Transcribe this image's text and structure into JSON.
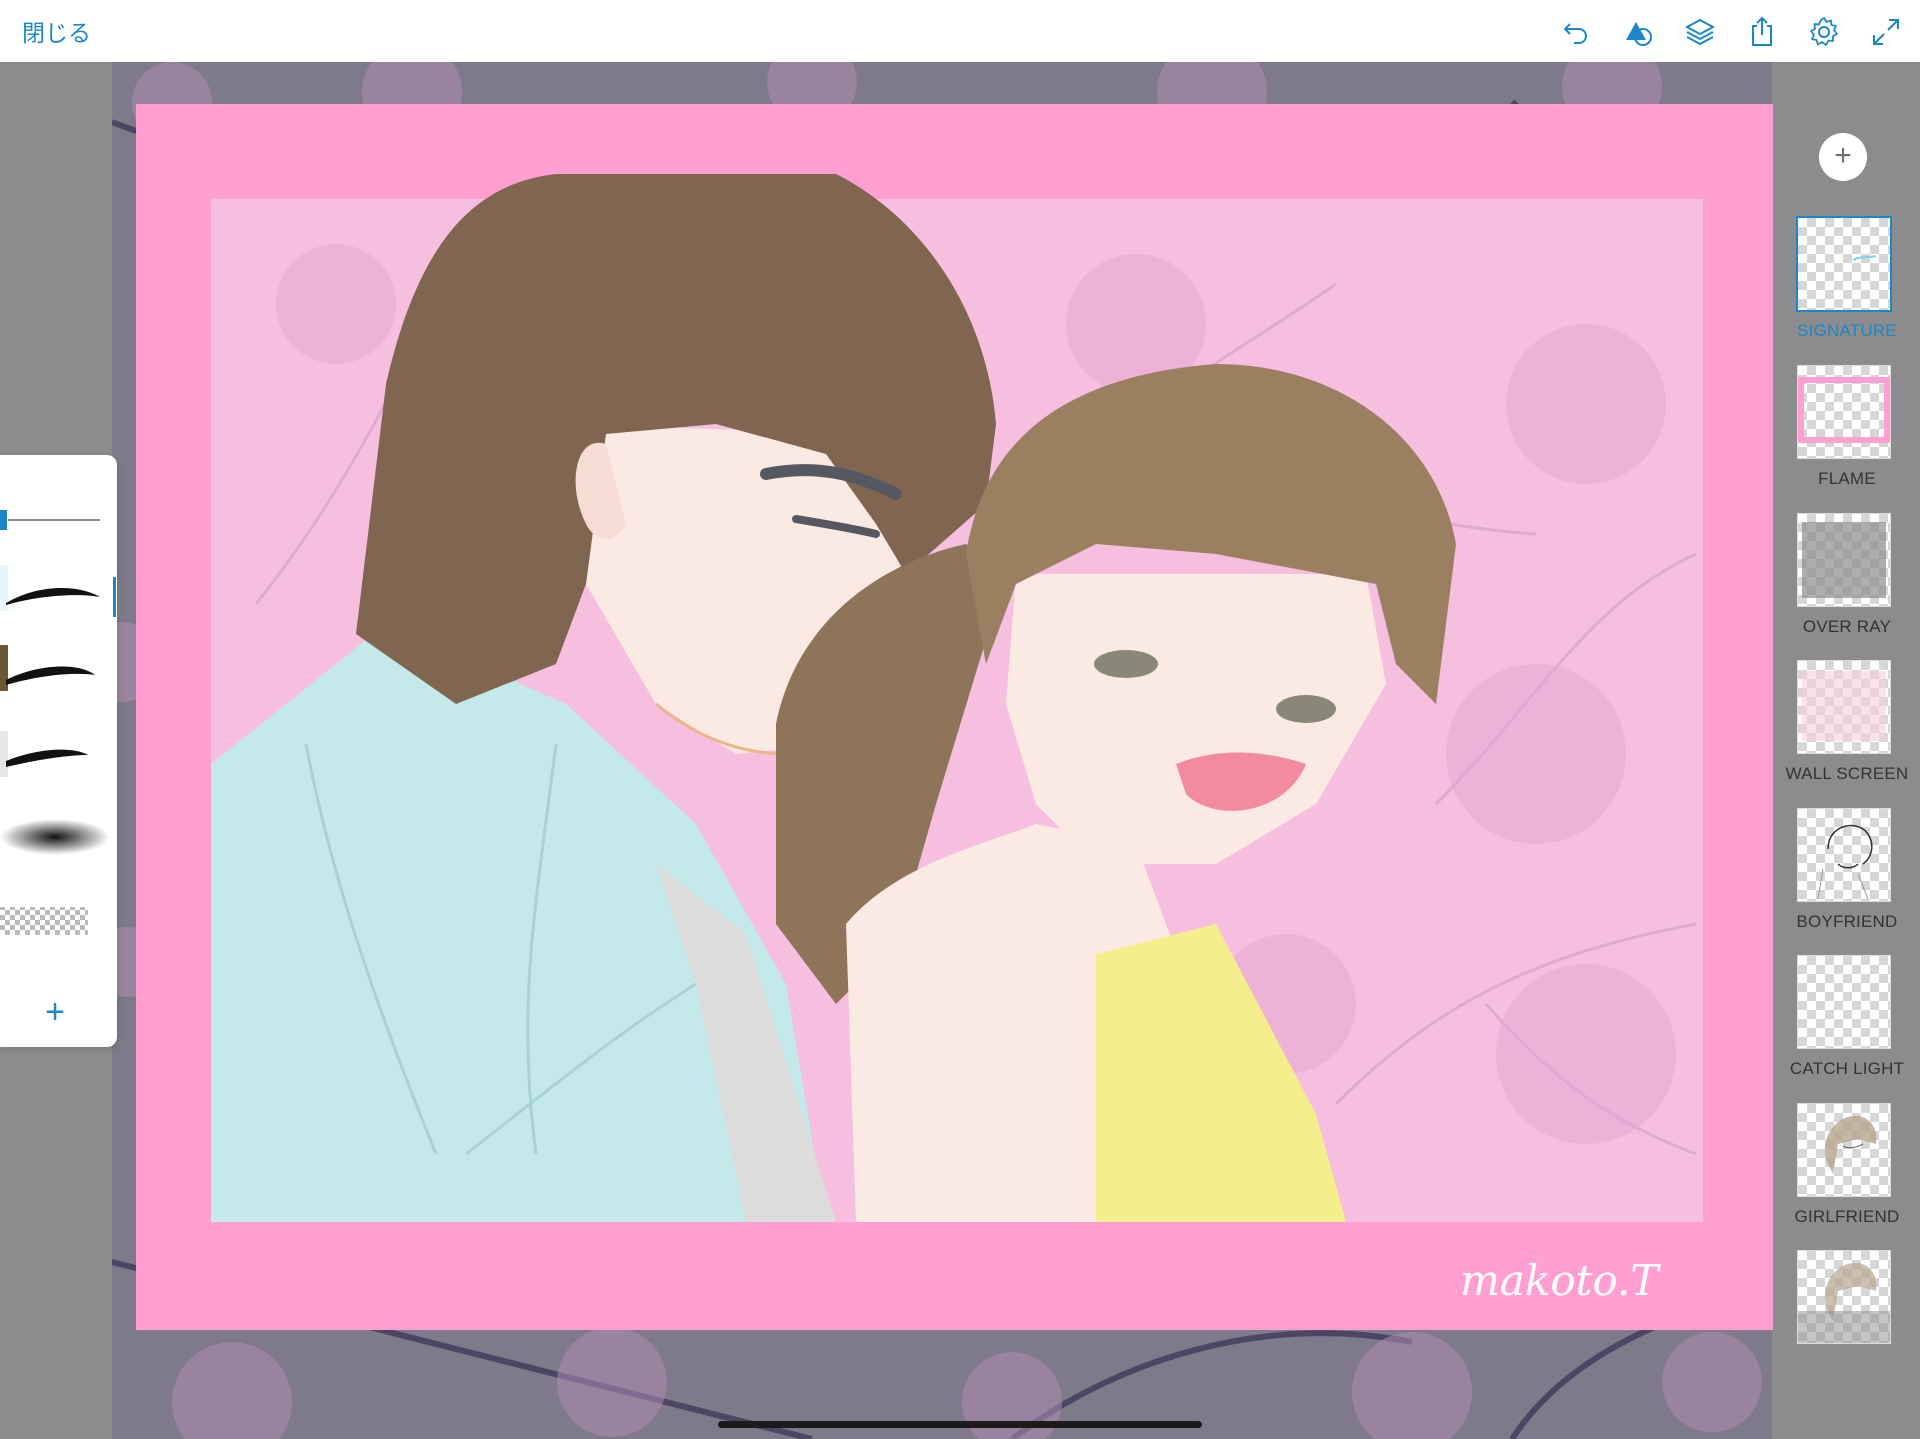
{
  "app": {
    "close_label": "閉じる",
    "accent_color": "#1a87c9"
  },
  "toolbar": {
    "icons": [
      "undo-icon",
      "shape-icon",
      "layers-icon",
      "share-icon",
      "settings-icon",
      "fullscreen-icon"
    ]
  },
  "canvas": {
    "signature_text": "makoto.T",
    "frame_color": "#ff9fd2"
  },
  "brushes": {
    "items": [
      "brush-thin-pen",
      "brush-ink-1",
      "brush-ink-2",
      "brush-ink-3",
      "brush-soft-airbrush",
      "brush-eraser"
    ],
    "add_label": "+"
  },
  "layers": {
    "add_label": "+",
    "items": [
      {
        "label": "SIGNATURE",
        "active": true
      },
      {
        "label": "FLAME",
        "active": false
      },
      {
        "label": "OVER RAY",
        "active": false
      },
      {
        "label": "WALL SCREEN",
        "active": false
      },
      {
        "label": "BOYFRIEND",
        "active": false
      },
      {
        "label": "CATCH LIGHT",
        "active": false
      },
      {
        "label": "GIRLFRIEND",
        "active": false
      },
      {
        "label": "",
        "active": false
      }
    ]
  }
}
